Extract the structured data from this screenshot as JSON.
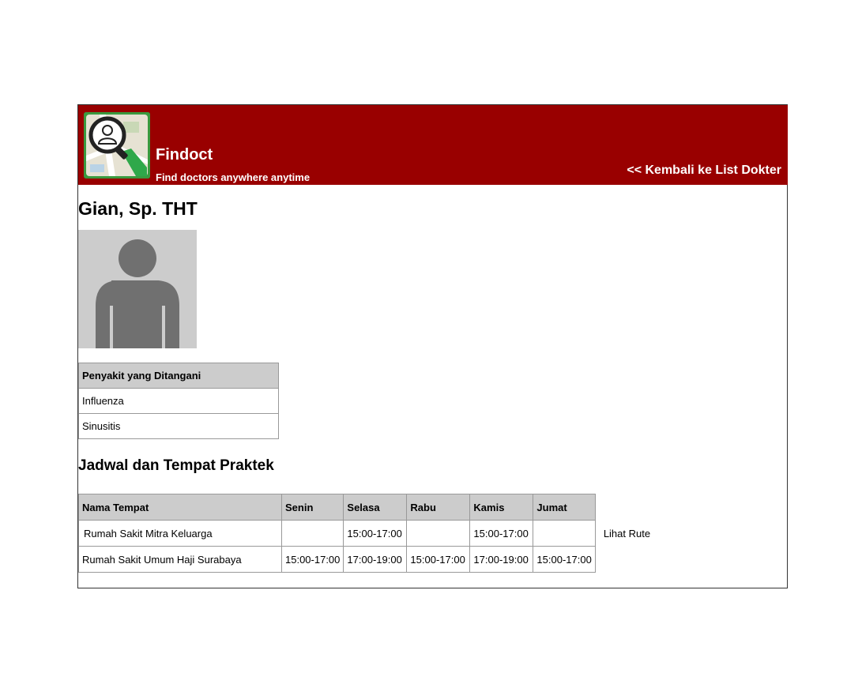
{
  "header": {
    "brand_title": "Findoct",
    "brand_subtitle": "Find doctors anywhere anytime",
    "back_link": "<< Kembali ke List Dokter",
    "background_color": "#990000"
  },
  "doctor": {
    "name": "Gian, Sp. THT",
    "avatar_icon": "person-placeholder-icon"
  },
  "diseases": {
    "header": "Penyakit yang Ditangani",
    "items": [
      "Influenza",
      "Sinusitis"
    ]
  },
  "schedule": {
    "title": "Jadwal dan Tempat Praktek",
    "columns": [
      "Nama Tempat",
      "Senin",
      "Selasa",
      "Rabu",
      "Kamis",
      "Jumat"
    ],
    "rows": [
      {
        "place": "Rumah Sakit Mitra Keluarga",
        "senin": "",
        "selasa": "15:00-17:00",
        "rabu": "",
        "kamis": "15:00-17:00",
        "jumat": "",
        "route": "Lihat Rute"
      },
      {
        "place": "Rumah Sakit Umum Haji Surabaya",
        "senin": "15:00-17:00",
        "selasa": "17:00-19:00",
        "rabu": "15:00-17:00",
        "kamis": "17:00-19:00",
        "jumat": "15:00-17:00",
        "route": ""
      }
    ]
  }
}
